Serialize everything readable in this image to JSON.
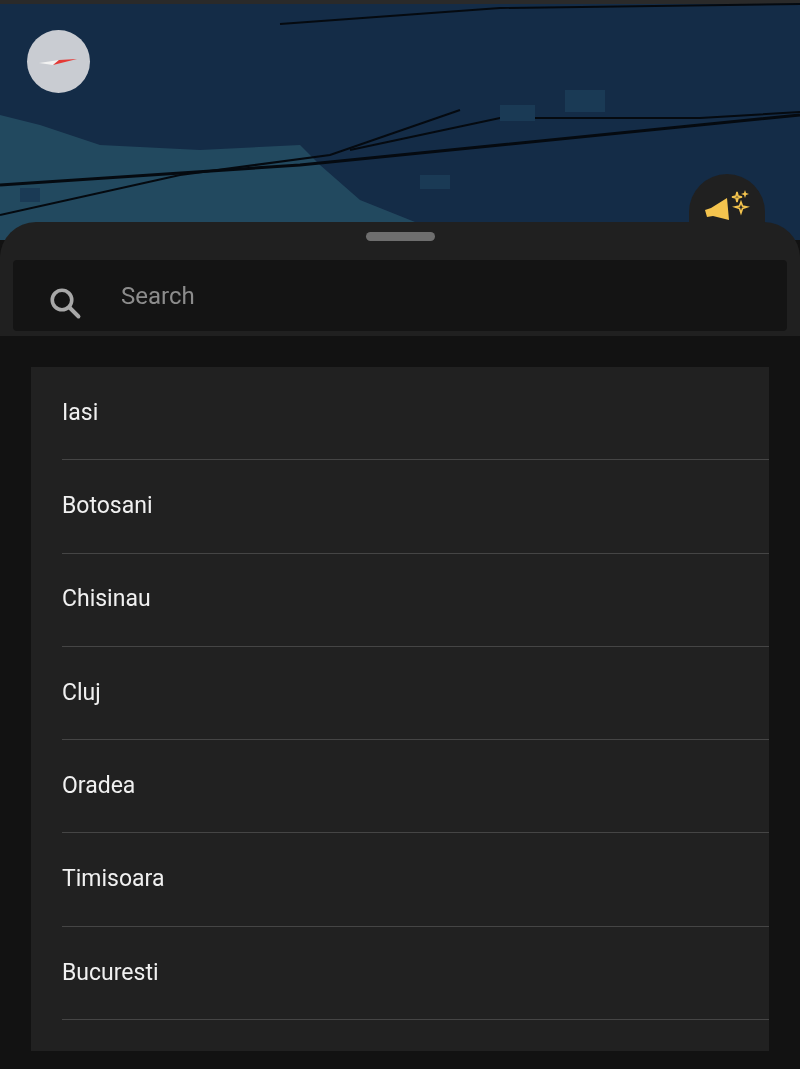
{
  "search": {
    "placeholder": "Search"
  },
  "places": [
    {
      "name": "Iasi"
    },
    {
      "name": "Botosani"
    },
    {
      "name": "Chisinau"
    },
    {
      "name": "Cluj"
    },
    {
      "name": "Oradea"
    },
    {
      "name": "Timisoara"
    },
    {
      "name": "Bucuresti"
    }
  ]
}
